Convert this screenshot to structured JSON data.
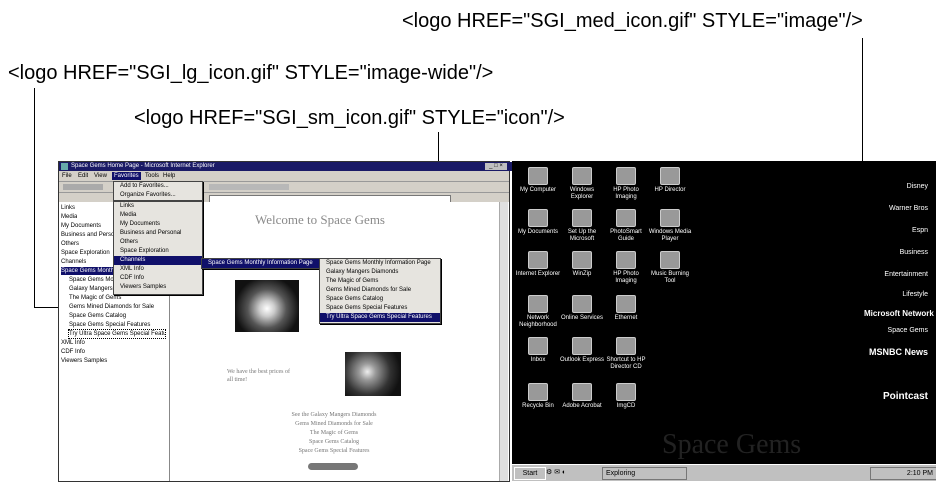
{
  "callouts": {
    "med": "<logo HREF=\"SGI_med_icon.gif\" STYLE=\"image\"/>",
    "lg": "<logo HREF=\"SGI_lg_icon.gif\" STYLE=\"image-wide\"/>",
    "sm": "<logo HREF=\"SGI_sm_icon.gif\" STYLE=\"icon\"/>"
  },
  "browser": {
    "title": "Space Gems Home Page - Microsoft Internet Explorer",
    "menu": [
      "File",
      "Edit",
      "View",
      "Favorites",
      "Tools",
      "Help"
    ],
    "favorites_menu": [
      "Add to Favorites...",
      "Organize Favorites..."
    ],
    "favorites_folders": [
      "Links",
      "Media",
      "My Documents",
      "Business and Personal",
      "Others",
      "Space Exploration",
      "Channels",
      "XML Info",
      "CDF Info",
      "Viewers Samples"
    ],
    "channel_menu": [
      "Space Gems Monthly Information Page",
      "Galaxy Mangers Diamonds",
      "The Magic of Gems",
      "Gems Mined Diamonds for Sale",
      "Space Gems Catalog",
      "Space Gems Special Features",
      "Try Ultra Space Gems Special Features"
    ],
    "channel_trigger": "Space Gems Monthly Information Page",
    "fav_pane_items": [
      "Links",
      "Media",
      "My Documents",
      "Business and Personal",
      "Others",
      "Space Exploration",
      "Channels",
      "Space Gems Monthly Information Page",
      "Space Gems Monthly Information Page",
      "Galaxy Mangers Diamonds",
      "The Magic of Gems",
      "Gems Mined Diamonds for Sale",
      "Space Gems Catalog",
      "Space Gems Special Features",
      "Try Ultra Space Gems Special Features",
      "XML Info",
      "CDF Info",
      "Viewers Samples"
    ],
    "welcome": "Welcome to Space Gems",
    "paragraph": [
      "We have the best prices of",
      "all time!"
    ],
    "links": [
      "See the Galaxy Mangers Diamonds",
      "Gems Mined Diamonds for Sale",
      "The Magic of Gems",
      "Space Gems Catalog",
      "Space Gems Special Features"
    ]
  },
  "desktop": {
    "icons": [
      [
        "My Computer",
        "Windows Explorer",
        "HP Photo Imaging",
        "HP Director"
      ],
      [
        "My Documents",
        "Set Up the Microsoft",
        "PhotoSmart Guide",
        "Windows Media Player"
      ],
      [
        "Internet Explorer",
        "WinZip",
        "HP Photo Imaging",
        "Music Burning Tool"
      ],
      [
        "Network Neighborhood",
        "Online Services",
        "Ethernet"
      ],
      [
        "Inbox",
        "Outlook Express",
        "Shortcut to HP Director CD"
      ],
      [
        "Recycle Bin",
        "Adobe Acrobat",
        "ImgCD"
      ]
    ],
    "channels": [
      "Disney",
      "Warner Bros",
      "Espn",
      "Business",
      "Entertainment",
      "Lifestyle",
      "Microsoft Network",
      "Space Gems",
      "MSNBC News",
      "Pointcast"
    ],
    "watermark": "Space Gems",
    "taskbar_start": "Start",
    "taskbar_task": "Exploring",
    "clock": "2:10 PM"
  }
}
